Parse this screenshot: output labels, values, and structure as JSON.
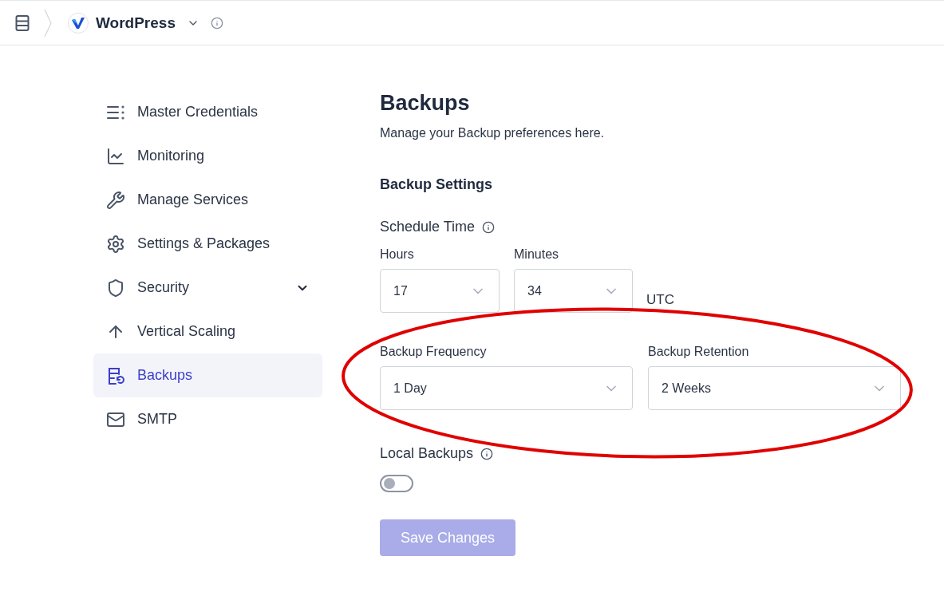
{
  "topbar": {
    "app_name": "WordPress"
  },
  "sidebar": {
    "items": [
      {
        "label": "Master Credentials",
        "kind": "link",
        "selected": false
      },
      {
        "label": "Monitoring",
        "kind": "link",
        "selected": false
      },
      {
        "label": "Manage Services",
        "kind": "link",
        "selected": false
      },
      {
        "label": "Settings & Packages",
        "kind": "link",
        "selected": false
      },
      {
        "label": "Security",
        "kind": "group",
        "selected": false
      },
      {
        "label": "Vertical Scaling",
        "kind": "link",
        "selected": false
      },
      {
        "label": "Backups",
        "kind": "link",
        "selected": true
      },
      {
        "label": "SMTP",
        "kind": "link",
        "selected": false
      }
    ]
  },
  "content": {
    "title": "Backups",
    "subtitle": "Manage your Backup preferences here.",
    "section": "Backup Settings",
    "schedule": {
      "label": "Schedule Time",
      "hours": {
        "label": "Hours",
        "value": "17"
      },
      "minutes": {
        "label": "Minutes",
        "value": "34"
      },
      "timezone": "UTC"
    },
    "frequency": {
      "label": "Backup Frequency",
      "value": "1 Day"
    },
    "retention": {
      "label": "Backup Retention",
      "value": "2 Weeks"
    },
    "local_backups": {
      "label": "Local Backups",
      "on": false
    },
    "save_button": {
      "label": "Save Changes",
      "disabled": true
    }
  }
}
